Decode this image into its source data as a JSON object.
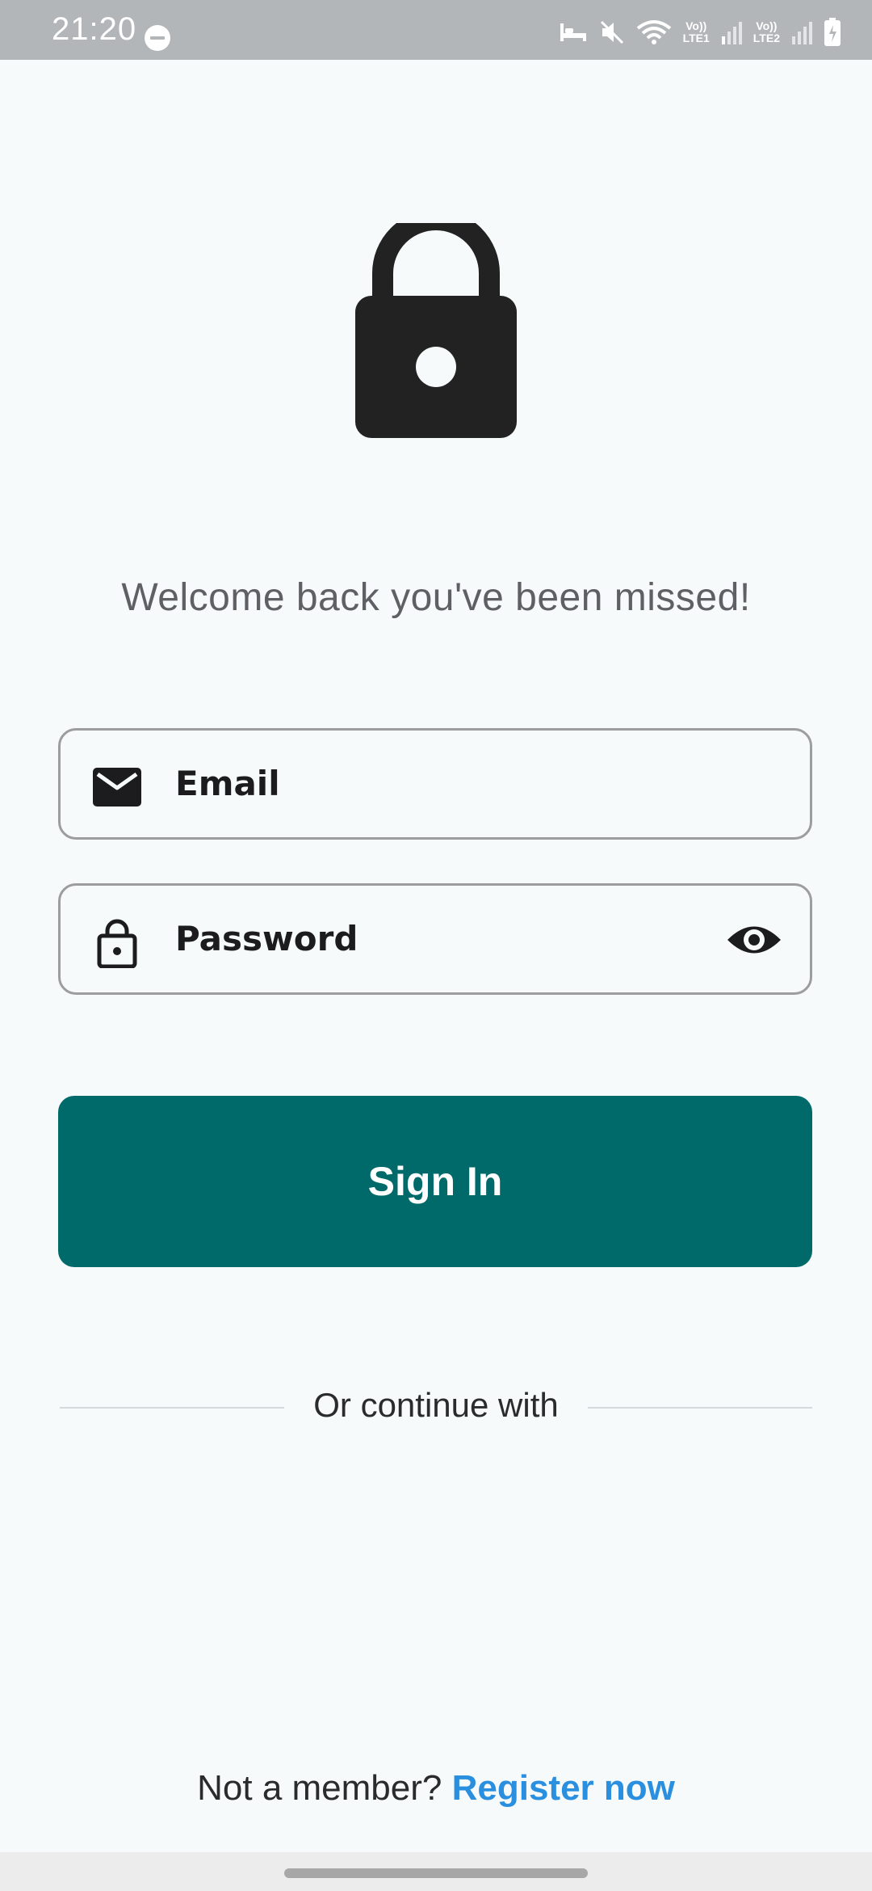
{
  "status_bar": {
    "time": "21:20",
    "sim1_label": "Vo))\nLTE1",
    "sim2_label": "Vo))\nLTE2",
    "icons": [
      "do-not-disturb-icon",
      "sleep-mode-icon",
      "mute-icon",
      "wifi-icon",
      "signal-icon",
      "battery-charging-icon"
    ]
  },
  "login": {
    "hero_icon": "lock-icon",
    "welcome_text": "Welcome back you've been missed!",
    "email_label": "Email",
    "email_icon": "mail-icon",
    "password_label": "Password",
    "password_icon": "lock-outline-icon",
    "password_visibility_icon": "eye-icon",
    "sign_in_label": "Sign In",
    "divider_text": "Or continue with",
    "footer_prompt": "Not a member?",
    "register_link": "Register now"
  },
  "colors": {
    "primary": "#006a6a",
    "link": "#2a8fde",
    "background": "#f6fafb",
    "status_bar": "#b3b6b8"
  }
}
